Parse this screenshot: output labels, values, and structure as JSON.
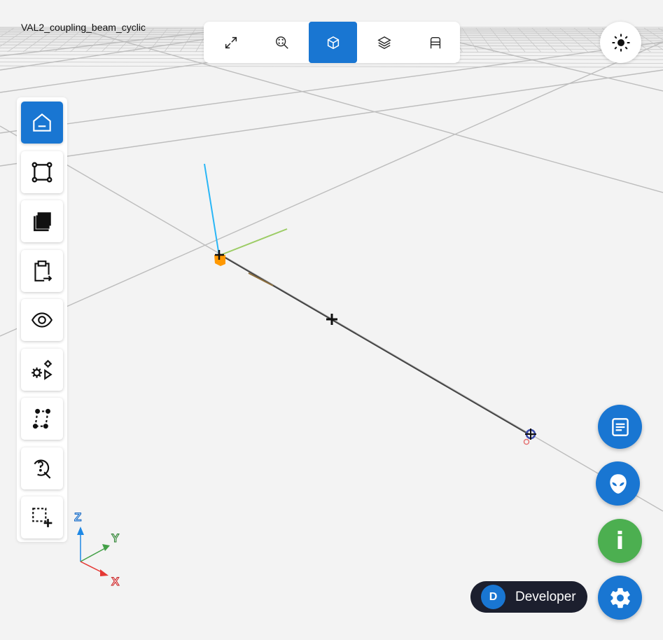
{
  "model": {
    "title": "VAL2_coupling_beam_cyclic"
  },
  "top_toolbar": {
    "items": [
      {
        "icon": "expand-icon",
        "active": false
      },
      {
        "icon": "zoom-fit-icon",
        "active": false
      },
      {
        "icon": "cube-3d-icon",
        "active": true
      },
      {
        "icon": "layers-icon",
        "active": false
      },
      {
        "icon": "section-icon",
        "active": false
      }
    ]
  },
  "theme_toggle": {
    "icon": "sun-icon"
  },
  "left_toolbar": {
    "items": [
      {
        "icon": "home-icon",
        "active": true
      },
      {
        "icon": "geometry-frame-icon",
        "active": false
      },
      {
        "icon": "collection-icon",
        "active": false
      },
      {
        "icon": "clipboard-export-icon",
        "active": false
      },
      {
        "icon": "eye-icon",
        "active": false
      },
      {
        "icon": "gears-run-icon",
        "active": false
      },
      {
        "icon": "mesh-nodes-icon",
        "active": false
      },
      {
        "icon": "query-search-icon",
        "active": false
      },
      {
        "icon": "select-add-icon",
        "active": false
      }
    ]
  },
  "axis_triad": {
    "z": "Z",
    "y": "Y",
    "x": "X"
  },
  "fabs": [
    {
      "icon": "notes-icon",
      "color": "#1976d2"
    },
    {
      "icon": "alien-icon",
      "color": "#1976d2"
    },
    {
      "icon": "info-icon",
      "label": "i",
      "color": "#4caf50"
    },
    {
      "icon": "settings-icon",
      "color": "#1976d2"
    }
  ],
  "user": {
    "initial": "D",
    "name": "Developer"
  },
  "colors": {
    "accent": "#1976d2",
    "success": "#4caf50",
    "chip_bg": "#1c1f2e",
    "axis_x": "#e53935",
    "axis_y": "#43a047",
    "axis_z": "#1e88e5"
  }
}
